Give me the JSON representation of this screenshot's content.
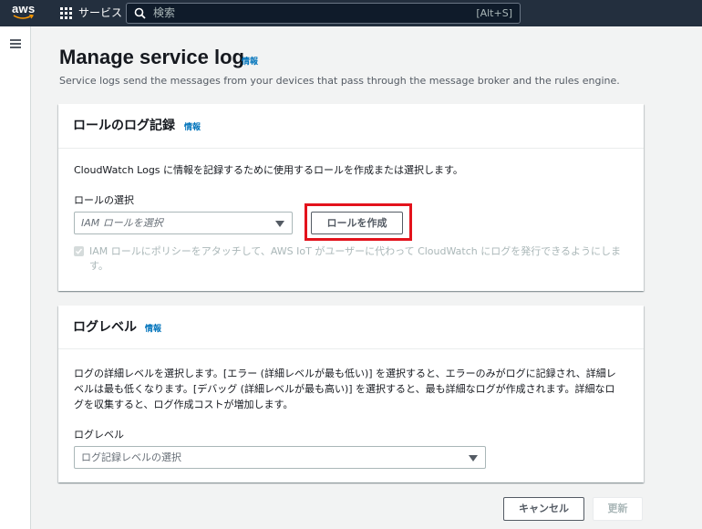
{
  "topbar": {
    "logo_text": "aws",
    "services_label": "サービス",
    "search_placeholder": "検索",
    "search_shortcut": "[Alt+S]",
    "background": "#232f3e"
  },
  "page": {
    "title": "Manage service log",
    "info_label": "情報",
    "description": "Service logs send the messages from your devices that pass through the message broker and the rules engine."
  },
  "role_logging": {
    "title": "ロールのログ記録",
    "info_label": "情報",
    "description": "CloudWatch Logs に情報を記録するために使用するロールを作成または選択します。",
    "role_select_label": "ロールの選択",
    "role_select_placeholder": "IAM ロールを選択",
    "create_role_button": "ロールを作成",
    "attach_policy_checkbox": {
      "checked": true,
      "disabled": true,
      "line1": "IAM ロールにポリシーをアタッチして、AWS IoT がユーザーに代わって CloudWatch にログを発行できるようにしま",
      "line2": "す。"
    }
  },
  "log_level": {
    "title": "ログレベル",
    "info_label": "情報",
    "description_line1": "ログの詳細レベルを選択します。[エラー (詳細レベルが最も低い)] を選択すると、エラーのみがログに記録され、詳細レ",
    "description_line2": "ベルは最も低くなります。[デバッグ (詳細レベルが最も高い)] を選択すると、最も詳細なログが作成されます。詳細なロ",
    "description_line3": "グを収集すると、ログ作成コストが増加します。",
    "select_label": "ログレベル",
    "select_placeholder": "ログ記録レベルの選択"
  },
  "footer": {
    "cancel_button": "キャンセル",
    "update_button": "更新"
  },
  "colors": {
    "link": "#0073bb",
    "highlight_border": "#e3131c",
    "page_background": "#f2f3f3"
  }
}
